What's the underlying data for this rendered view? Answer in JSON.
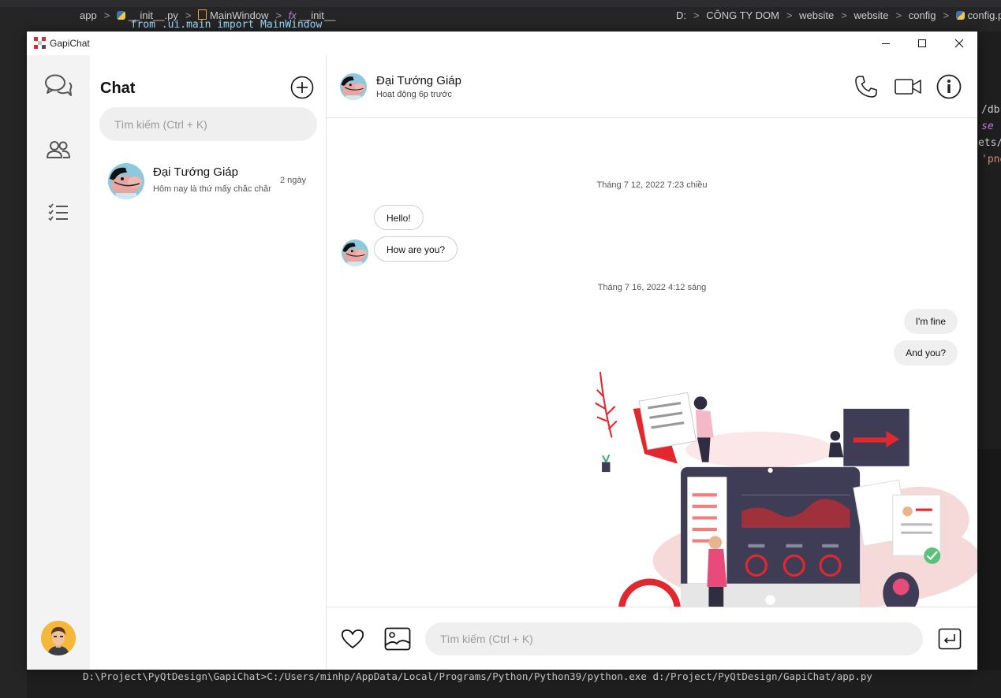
{
  "ide": {
    "breadcrumb_left": [
      "app",
      "__init__.py",
      "MainWindow",
      "__init__"
    ],
    "breadcrumb_right": [
      "D:",
      "CÔNG TY DOM",
      "website",
      "website",
      "config",
      "config.py"
    ],
    "code_line": "  from .ui.main import MainWindow",
    "side_code": [
      "/db",
      "se",
      "ets/(",
      "'png"
    ],
    "terminal": "D:\\Project\\PyQtDesign\\GapiChat>C:/Users/minhp/AppData/Local/Programs/Python/Python39/python.exe d:/Project/PyQtDesign/GapiChat/app.py"
  },
  "window": {
    "title": "GapiChat",
    "minimize_icon": "minimize-icon",
    "maximize_icon": "maximize-icon",
    "close_icon": "close-icon"
  },
  "nav": {
    "items": [
      {
        "name": "chat",
        "icon": "chat-bubbles-icon"
      },
      {
        "name": "contacts",
        "icon": "users-icon"
      },
      {
        "name": "tasks",
        "icon": "checklist-icon"
      }
    ],
    "profile_icon": "user-avatar"
  },
  "chat_list": {
    "title": "Chat",
    "new_chat_icon": "plus-circle-icon",
    "search_placeholder": "Tìm kiếm (Ctrl + K)",
    "conversations": [
      {
        "name": "Đại Tướng Giáp",
        "preview": "Hôm nay là thứ mấy chắc chắn",
        "time": "2 ngày"
      }
    ]
  },
  "conversation": {
    "contact_name": "Đại Tướng Giáp",
    "status": "Hoạt động 6p trước",
    "actions": [
      "phone-icon",
      "video-icon",
      "info-icon"
    ],
    "messages": [
      {
        "type": "timestamp",
        "text": "Tháng 7 12, 2022 7:23 chiều"
      },
      {
        "type": "incoming",
        "text": "Hello!"
      },
      {
        "type": "incoming",
        "text": "How are you?"
      },
      {
        "type": "timestamp",
        "text": "Tháng 7 16, 2022 4:12 sáng"
      },
      {
        "type": "outgoing",
        "text": "I'm fine"
      },
      {
        "type": "outgoing",
        "text": "And you?"
      }
    ],
    "composer": {
      "like_icon": "heart-icon",
      "image_icon": "image-icon",
      "placeholder": "Tìm kiếm (Ctrl + K)",
      "send_icon": "enter-icon"
    }
  },
  "colors": {
    "accent_red": "#e0282e",
    "dark_navy": "#3f3d56",
    "bubble_out": "#efefef",
    "rail_bg": "#f3f3f3"
  }
}
